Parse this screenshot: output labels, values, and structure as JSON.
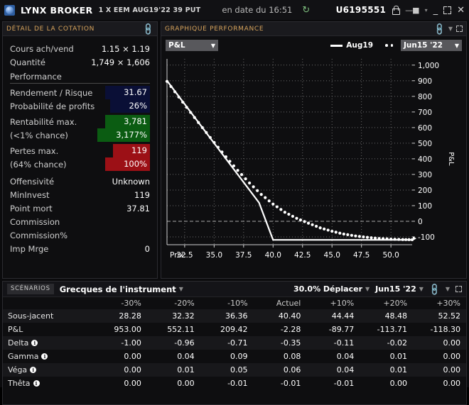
{
  "titlebar": {
    "brand": "LYNX BROKER",
    "contract": "1 X EEM AUG19'22 39 PUT",
    "as_of": "en date du 16:51",
    "refresh_icon": "refresh-icon",
    "account": "U6195551",
    "lock_icon": "lock-icon",
    "pin_icon": "pin-icon",
    "pin_caret": "▾",
    "minimize": "_",
    "maximize_icon": "maximize-icon",
    "close": "✕"
  },
  "quote_panel": {
    "header": "DÉTAIL DE LA COTATION",
    "link_icon": "link-icon",
    "rows": [
      {
        "label": "Cours ach/vend",
        "value": "1.15 × 1.19"
      },
      {
        "label": "Quantité",
        "value": "1,749 × 1,606"
      }
    ],
    "performance_header": "Performance",
    "perf": [
      {
        "label": "Rendement / Risque",
        "value": "31.67",
        "bg": "blue"
      },
      {
        "label": "Probabilité de profits",
        "value": "26%",
        "bg": "blue"
      }
    ],
    "max_profit": {
      "label": "Rentabilité max.",
      "value": "3,781",
      "sub_label": "(<1% chance)",
      "sub_value": "3,177%",
      "bg": "green"
    },
    "max_loss": {
      "label": "Pertes max.",
      "value": "119",
      "sub_label": "(64% chance)",
      "sub_value": "100%",
      "bg": "red"
    },
    "tail": [
      {
        "label": "Offensivité",
        "value": "Unknown"
      },
      {
        "label": "MinInvest",
        "value": "119"
      },
      {
        "label": "Point mort",
        "value": "37.81"
      },
      {
        "label": "Commission",
        "value": ""
      },
      {
        "label": "Commission%",
        "value": ""
      },
      {
        "label": "Imp Mrge",
        "value": "0"
      }
    ]
  },
  "chart_panel": {
    "header": "GRAPHIQUE PERFORMANCE",
    "link_icon": "link-icon",
    "caret_icon": "chevron-down-icon",
    "expand_icon": "expand-icon",
    "metric_select": {
      "value": "P&L",
      "arrow": "▼"
    },
    "legend_line_label": "Aug19",
    "expiry_select": {
      "value": "Jun15 '22",
      "arrow": "▼"
    },
    "x_axis_prefix": "Prix:"
  },
  "chart_data": {
    "type": "line",
    "title": "GRAPHIQUE PERFORMANCE",
    "xlabel": "Prix:",
    "ylabel": "P&L",
    "xlim": [
      31.0,
      51.8
    ],
    "ylim": [
      -150,
      1040
    ],
    "xticks": [
      "32.5",
      "35.0",
      "37.5",
      "40.0",
      "42.5",
      "45.0",
      "47.5",
      "50.0"
    ],
    "xtick_values": [
      32.5,
      35.0,
      37.5,
      40.0,
      42.5,
      45.0,
      47.5,
      50.0
    ],
    "yticks": [
      "1,000",
      "900",
      "800",
      "700",
      "600",
      "500",
      "400",
      "300",
      "200",
      "100",
      "0",
      "-100"
    ],
    "ytick_values": [
      1000,
      900,
      800,
      700,
      600,
      500,
      400,
      300,
      200,
      100,
      0,
      -100
    ],
    "grid": true,
    "zero_line": 0,
    "legend_position": "top-right",
    "series": [
      {
        "name": "Aug19",
        "style": "solid",
        "color": "#ffffff",
        "x": [
          31.0,
          32.5,
          35.0,
          37.5,
          38.81,
          40.0,
          42.5,
          45.0,
          47.5,
          50.0,
          51.8
        ],
        "y": [
          900,
          750,
          500,
          250,
          119,
          -119,
          -119,
          -119,
          -119,
          -119,
          -119
        ]
      },
      {
        "name": "Jun15 '22",
        "style": "dotted",
        "color": "#ffffff",
        "x": [
          31.0,
          32.0,
          33.0,
          34.0,
          35.0,
          36.0,
          37.0,
          38.0,
          39.0,
          40.0,
          41.0,
          42.0,
          43.0,
          44.0,
          45.0,
          46.0,
          47.0,
          48.0,
          49.0,
          50.0,
          51.0,
          51.8
        ],
        "y": [
          896,
          796,
          697,
          600,
          505,
          413,
          326,
          245,
          172,
          110,
          58,
          19,
          -12,
          -42,
          -64,
          -82,
          -94,
          -103,
          -110,
          -114,
          -117,
          -118
        ]
      }
    ]
  },
  "scenarios": {
    "tab": "SCÉNARIOS",
    "title": "Grecques de l'instrument",
    "title_arrow": "▼",
    "shift_control": "30.0% Déplacer",
    "shift_arrow": "▼",
    "expiry_control": "Jun15 '22",
    "expiry_arrow": "▼",
    "link_icon": "link-icon",
    "caret_icon": "chevron-down-icon",
    "expand_icon": "expand-icon",
    "columns": [
      "",
      "-30%",
      "-20%",
      "-10%",
      "Actuel",
      "+10%",
      "+20%",
      "+30%"
    ],
    "rows": [
      {
        "label": "Sous-jacent",
        "info": false,
        "values": [
          "28.28",
          "32.32",
          "36.36",
          "40.40",
          "44.44",
          "48.48",
          "52.52"
        ]
      },
      {
        "label": "P&L",
        "info": false,
        "values": [
          "953.00",
          "552.11",
          "209.42",
          "-2.28",
          "-89.77",
          "-113.71",
          "-118.30"
        ]
      },
      {
        "label": "Delta",
        "info": true,
        "values": [
          "-1.00",
          "-0.96",
          "-0.71",
          "-0.35",
          "-0.11",
          "-0.02",
          "0.00"
        ]
      },
      {
        "label": "Gamma",
        "info": true,
        "values": [
          "0.00",
          "0.04",
          "0.09",
          "0.08",
          "0.04",
          "0.01",
          "0.00"
        ]
      },
      {
        "label": "Véga",
        "info": true,
        "values": [
          "0.00",
          "0.01",
          "0.05",
          "0.06",
          "0.04",
          "0.01",
          "0.00"
        ]
      },
      {
        "label": "Thêta",
        "info": true,
        "values": [
          "0.00",
          "0.00",
          "-0.01",
          "-0.01",
          "-0.01",
          "0.00",
          "0.00"
        ]
      }
    ]
  }
}
